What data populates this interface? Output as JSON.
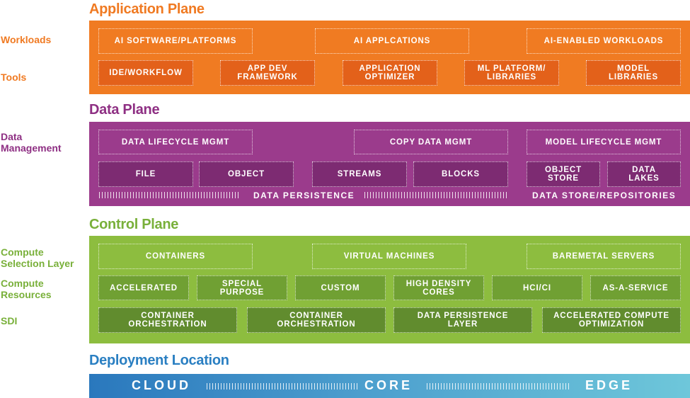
{
  "application_plane": {
    "title": "Application Plane",
    "side_labels": [
      "Workloads",
      "Tools"
    ],
    "workloads": [
      "AI SOFTWARE/PLATFORMS",
      "AI APPLCATIONS",
      "AI-ENABLED WORKLOADS"
    ],
    "tools": [
      {
        "line1": "IDE/WORKFLOW",
        "line2": ""
      },
      {
        "line1": "APP DEV",
        "line2": "FRAMEWORK"
      },
      {
        "line1": "APPLICATION",
        "line2": "OPTIMIZER"
      },
      {
        "line1": "ML PLATFORM/",
        "line2": "LIBRARIES"
      },
      {
        "line1": "MODEL",
        "line2": "LIBRARIES"
      }
    ]
  },
  "data_plane": {
    "title": "Data Plane",
    "side_label": [
      "Data",
      "Management"
    ],
    "management": [
      "DATA LIFECYCLE MGMT",
      "COPY DATA MGMT",
      "MODEL LIFECYCLE MGMT"
    ],
    "persistence": [
      "FILE",
      "OBJECT",
      "STREAMS",
      "BLOCKS"
    ],
    "repositories": [
      {
        "line1": "OBJECT",
        "line2": "STORE"
      },
      {
        "line1": "DATA",
        "line2": "LAKES"
      }
    ],
    "persistence_label": "DATA PERSISTENCE",
    "repositories_label": "DATA STORE/REPOSITORIES"
  },
  "control_plane": {
    "title": "Control Plane",
    "side_labels": [
      {
        "line1": "Compute",
        "line2": "Selection Layer"
      },
      {
        "line1": "Compute",
        "line2": "Resources"
      },
      {
        "line1": "SDI",
        "line2": ""
      }
    ],
    "selection": [
      "CONTAINERS",
      "VIRTUAL MACHINES",
      "BAREMETAL SERVERS"
    ],
    "resources": [
      {
        "line1": "ACCELERATED",
        "line2": ""
      },
      {
        "line1": "SPECIAL",
        "line2": "PURPOSE"
      },
      {
        "line1": "CUSTOM",
        "line2": ""
      },
      {
        "line1": "HIGH DENSITY",
        "line2": "CORES"
      },
      {
        "line1": "HCI/CI",
        "line2": ""
      },
      {
        "line1": "AS-A-SERVICE",
        "line2": ""
      }
    ],
    "sdi": [
      {
        "line1": "CONTAINER",
        "line2": "ORCHESTRATION"
      },
      {
        "line1": "CONTAINER",
        "line2": "ORCHESTRATION"
      },
      {
        "line1": "DATA PERSISTENCE",
        "line2": "LAYER"
      },
      {
        "line1": "ACCELERATED COMPUTE",
        "line2": "OPTIMIZATION"
      }
    ]
  },
  "deployment": {
    "title": "Deployment Location",
    "locations": [
      "CLOUD",
      "CORE",
      "EDGE"
    ]
  }
}
